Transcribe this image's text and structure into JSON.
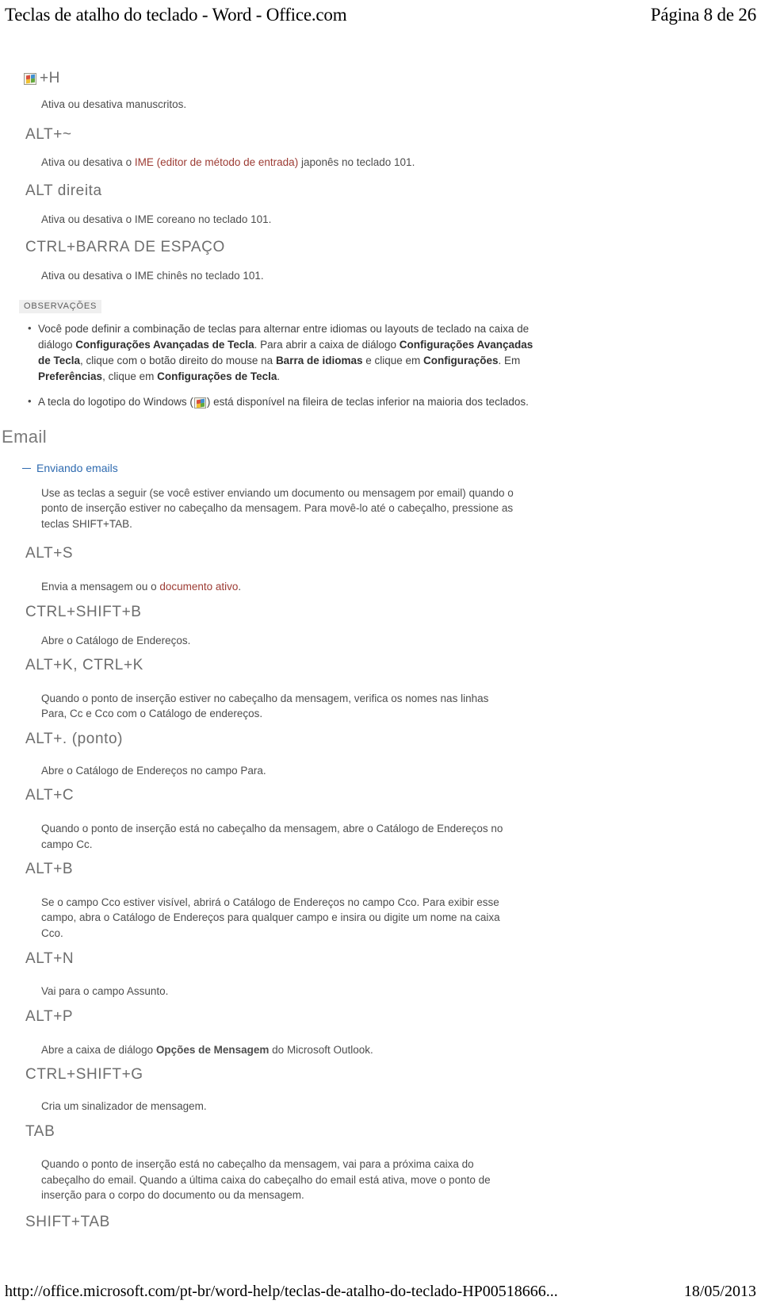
{
  "print_header": {
    "title": "Teclas de atalho do teclado - Word - Office.com",
    "page_label": "Página 8 de 26"
  },
  "print_footer": {
    "url": "http://office.microsoft.com/pt-br/word-help/teclas-de-atalho-do-teclado-HP00518666...",
    "date": "18/05/2013"
  },
  "icons": {
    "windows_logo": "windows-logo-icon",
    "collapse": "minus-collapse-icon"
  },
  "colors": {
    "key_heading": "#6e6e6e",
    "body_text": "#4d4d4d",
    "glossary_link": "#9c3b33",
    "expander_link": "#2f6bb0",
    "notes_tag_bg": "#efefef"
  },
  "content": {
    "win_h_shortcut": {
      "suffix": "+H",
      "description": "Ativa ou desativa manuscritos."
    },
    "entries": [
      {
        "key": "ALT+~",
        "desc_prefix": "Ativa ou desativa o ",
        "desc_glossary": "IME (editor de método de entrada)",
        "desc_suffix": " japonês no teclado 101."
      },
      {
        "key": "ALT direita",
        "description": "Ativa ou desativa o IME coreano no teclado 101."
      },
      {
        "key": "CTRL+BARRA DE ESPAÇO",
        "description": "Ativa ou desativa o IME chinês no teclado 101."
      }
    ],
    "notes": {
      "tag": "OBSERVAÇÕES",
      "items": [
        {
          "parts": [
            {
              "t": "Você pode definir a combinação de teclas para alternar entre idiomas ou layouts de teclado na caixa de diálogo ",
              "b": false
            },
            {
              "t": "Configurações Avançadas de Tecla",
              "b": true
            },
            {
              "t": ". Para abrir a caixa de diálogo ",
              "b": false
            },
            {
              "t": "Configurações Avançadas de Tecla",
              "b": true
            },
            {
              "t": ", clique com o botão direito do mouse na ",
              "b": false
            },
            {
              "t": "Barra de idiomas",
              "b": true
            },
            {
              "t": " e clique em ",
              "b": false
            },
            {
              "t": "Configurações",
              "b": true
            },
            {
              "t": ". Em ",
              "b": false
            },
            {
              "t": "Preferências",
              "b": true
            },
            {
              "t": ", clique em ",
              "b": false
            },
            {
              "t": "Configurações de Tecla",
              "b": true
            },
            {
              "t": ".",
              "b": false
            }
          ]
        },
        {
          "icon_note": true,
          "before_icon": "A tecla do logotipo do Windows (",
          "after_icon": ") está disponível na fileira de teclas inferior na maioria dos teclados."
        }
      ]
    },
    "email_section": {
      "heading": "Email",
      "expander_label": "Enviando emails",
      "intro": "Use as teclas a seguir (se você estiver enviando um documento ou mensagem por email) quando o ponto de inserção estiver no cabeçalho da mensagem. Para movê-lo até o cabeçalho, pressione as teclas SHIFT+TAB.",
      "shortcuts": [
        {
          "key": "ALT+S",
          "desc_prefix": "Envia a mensagem ou o ",
          "desc_glossary": "documento ativo",
          "desc_suffix": "."
        },
        {
          "key": "CTRL+SHIFT+B",
          "description": "Abre o Catálogo de Endereços."
        },
        {
          "key": "ALT+K, CTRL+K",
          "description": "Quando o ponto de inserção estiver no cabeçalho da mensagem, verifica os nomes nas linhas Para, Cc e Cco com o Catálogo de endereços."
        },
        {
          "key": "ALT+. (ponto)",
          "description": "Abre o Catálogo de Endereços no campo Para."
        },
        {
          "key": "ALT+C",
          "description": "Quando o ponto de inserção está no cabeçalho da mensagem, abre o Catálogo de Endereços no campo Cc."
        },
        {
          "key": "ALT+B",
          "description": "Se o campo Cco estiver visível, abrirá o Catálogo de Endereços no campo Cco. Para exibir esse campo, abra o Catálogo de Endereços para qualquer campo e insira ou digite um nome na caixa Cco."
        },
        {
          "key": "ALT+N",
          "description": "Vai para o campo Assunto."
        },
        {
          "key": "ALT+P",
          "desc_parts": [
            {
              "t": "Abre a caixa de diálogo ",
              "b": false
            },
            {
              "t": "Opções de Mensagem",
              "b": true
            },
            {
              "t": " do Microsoft Outlook.",
              "b": false
            }
          ]
        },
        {
          "key": "CTRL+SHIFT+G",
          "description": "Cria um sinalizador de mensagem."
        },
        {
          "key": "TAB",
          "description": "Quando o ponto de inserção está no cabeçalho da mensagem, vai para a próxima caixa do cabeçalho do email. Quando a última caixa do cabeçalho do email está ativa, move o ponto de inserção para o corpo do documento ou da mensagem."
        },
        {
          "key": "SHIFT+TAB",
          "description": ""
        }
      ]
    }
  }
}
